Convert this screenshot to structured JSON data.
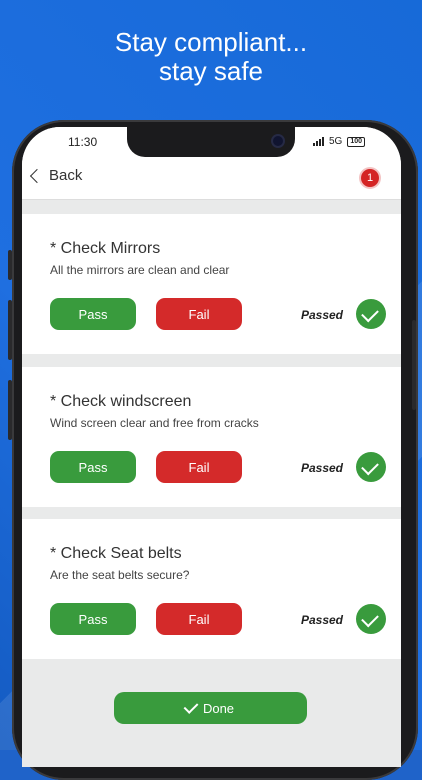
{
  "headline": {
    "line1": "Stay compliant...",
    "line2": "stay safe"
  },
  "status_bar": {
    "time": "11:30",
    "network": "5G",
    "battery": "100"
  },
  "nav": {
    "back_label": "Back",
    "notification_count": "1"
  },
  "checks": [
    {
      "title": "* Check Mirrors",
      "description": "All the mirrors are clean and clear",
      "pass_label": "Pass",
      "fail_label": "Fail",
      "status": "Passed"
    },
    {
      "title": "* Check windscreen",
      "description": "Wind screen clear and free from cracks",
      "pass_label": "Pass",
      "fail_label": "Fail",
      "status": "Passed"
    },
    {
      "title": "* Check Seat belts",
      "description": "Are the seat belts secure?",
      "pass_label": "Pass",
      "fail_label": "Fail",
      "status": "Passed"
    }
  ],
  "done_label": "Done",
  "colors": {
    "pass": "#399b3d",
    "fail": "#d42a2a",
    "badge": "#d42424",
    "background": "#1f63c9"
  },
  "icons": {
    "back": "chevron-left-icon",
    "status": "check-circle-icon",
    "done": "check-icon"
  }
}
